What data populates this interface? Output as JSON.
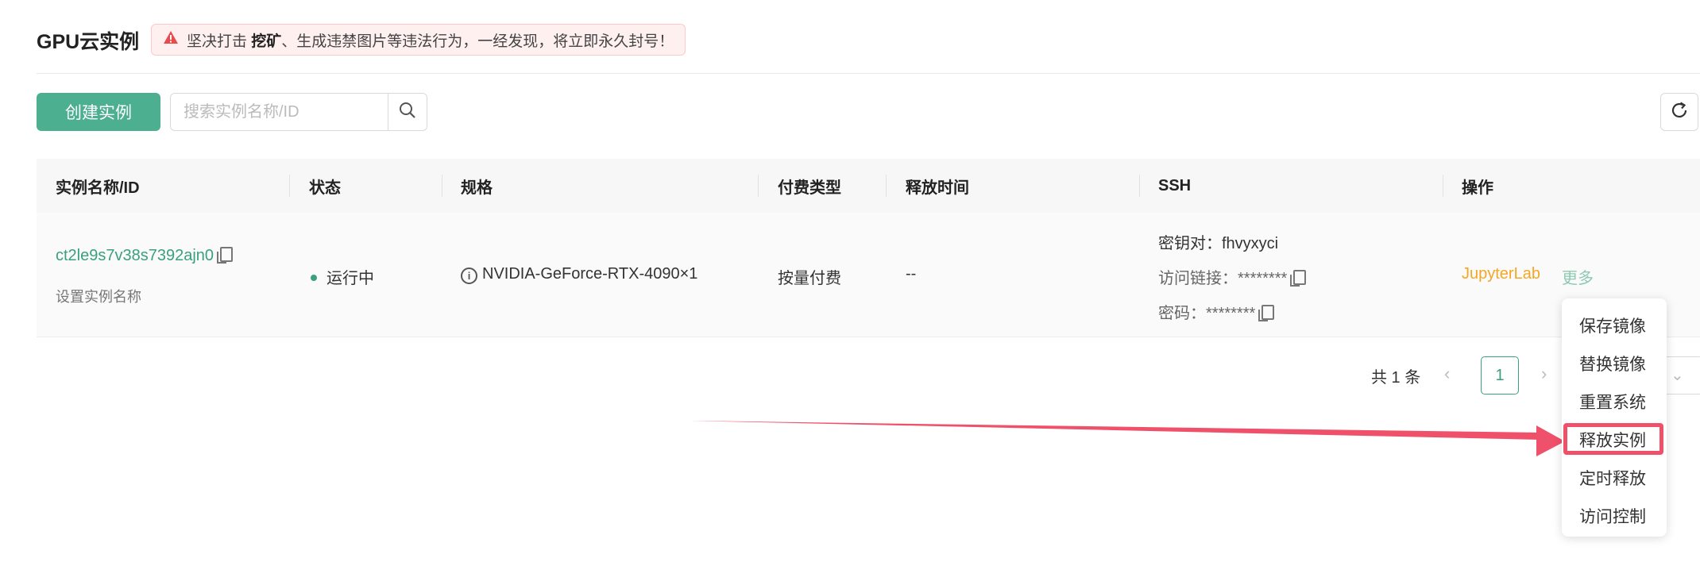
{
  "page": {
    "title": "GPU云实例",
    "warning": {
      "prefix": "坚决打击 ",
      "emphasis": "挖矿",
      "suffix": "、生成违禁图片等违法行为，一经发现，将立即永久封号！",
      "icon": "warning-triangle-icon",
      "color": "#e74c4c"
    }
  },
  "toolbar": {
    "create_label": "创建实例",
    "search_placeholder": "搜索实例名称/ID",
    "search_icon": "search-icon",
    "refresh_icon": "refresh-icon"
  },
  "table": {
    "columns": [
      "实例名称/ID",
      "状态",
      "规格",
      "付费类型",
      "释放时间",
      "SSH",
      "操作"
    ],
    "row": {
      "id": "ct2le9s7v38s7392ajn0",
      "set_name": "设置实例名称",
      "status": "运行中",
      "spec": "NVIDIA-GeForce-RTX-4090×1",
      "billing": "按量付费",
      "release_time": "--",
      "ssh_keypair": "密钥对：fhvyxyci",
      "ssh_link": "访问链接：********",
      "ssh_password": "密码：********",
      "action_primary": "JupyterLab",
      "action_more": "更多"
    }
  },
  "pagination": {
    "total": "共 1 条",
    "current": "1"
  },
  "dropdown": {
    "items": [
      "保存镜像",
      "替换镜像",
      "重置系统",
      "释放实例",
      "定时释放",
      "访问控制"
    ],
    "highlighted_index": 3
  },
  "colors": {
    "accent": "#4caf8f",
    "link": "#3aa07e",
    "orange": "#f5a623",
    "annotation": "#f0516a"
  }
}
